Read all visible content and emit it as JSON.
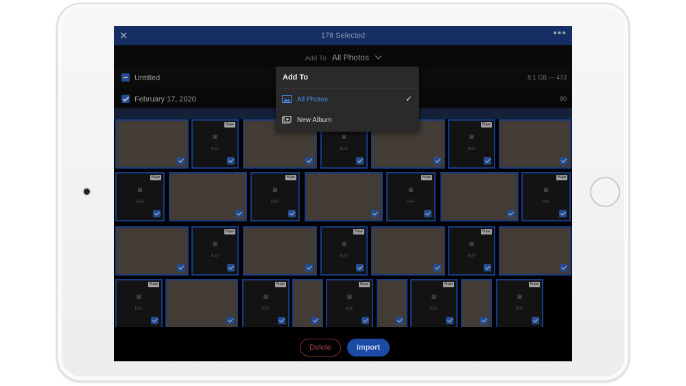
{
  "header": {
    "close_label": "✕",
    "title": "176 Selected",
    "more_label": "•••"
  },
  "add_to_bar": {
    "label": "Add To",
    "value": "All Photos"
  },
  "sections": [
    {
      "name": "Untitled",
      "meta": "8.1 GB — 473"
    },
    {
      "name": "February 17, 2020",
      "meta": "80"
    }
  ],
  "dropdown": {
    "heading": "Add To",
    "items": [
      {
        "label": "All Photos",
        "selected": true,
        "icon": "photo-icon"
      },
      {
        "label": "New Album",
        "selected": false,
        "icon": "new-album-icon"
      }
    ],
    "check_mark": "✓"
  },
  "tile_labels": {
    "raw_tag": "Raw",
    "raf_text": "RAF",
    "camera_glyph": "📷"
  },
  "actions": {
    "delete_label": "Delete",
    "import_label": "Import"
  },
  "colors": {
    "header_bg": "#1c3f87",
    "accent_blue": "#2f64c4",
    "selected_text": "#4a8bf0",
    "delete_red": "#a94444"
  }
}
